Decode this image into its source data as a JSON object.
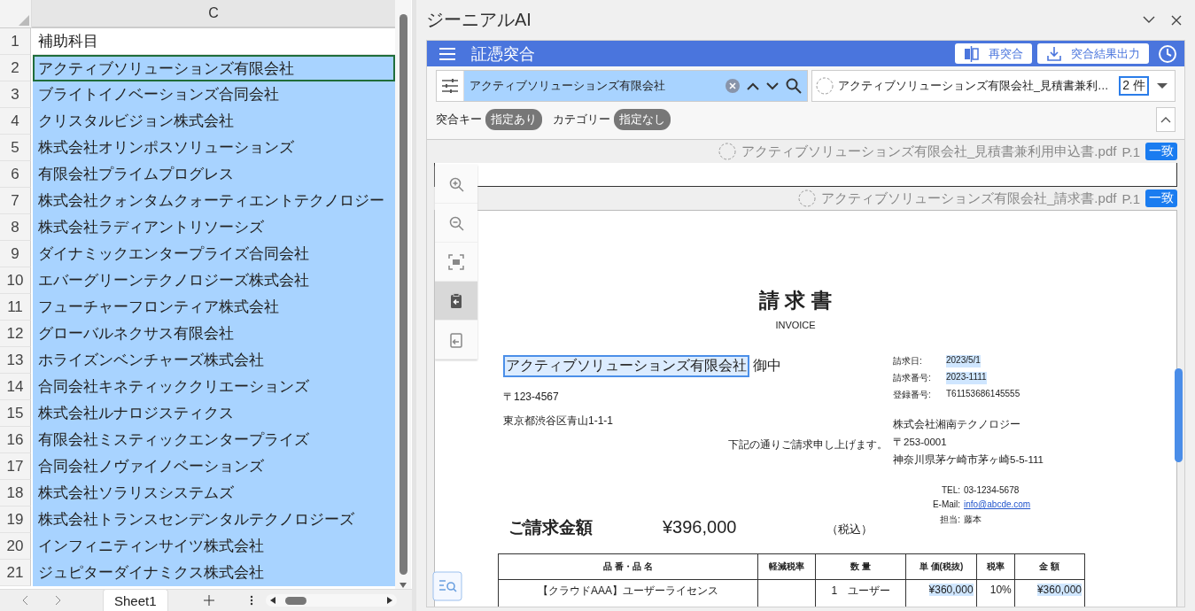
{
  "sheet": {
    "column": "C",
    "rows": [
      {
        "number": "1",
        "value": "補助科目",
        "selected": false,
        "active": false
      },
      {
        "number": "2",
        "value": "アクティブソリューションズ有限会社",
        "selected": true,
        "active": true
      },
      {
        "number": "3",
        "value": "ブライトイノベーションズ合同会社",
        "selected": true,
        "active": false
      },
      {
        "number": "4",
        "value": "クリスタルビジョン株式会社",
        "selected": true,
        "active": false
      },
      {
        "number": "5",
        "value": "株式会社オリンポスソリューションズ",
        "selected": true,
        "active": false
      },
      {
        "number": "6",
        "value": "有限会社プライムプログレス",
        "selected": true,
        "active": false
      },
      {
        "number": "7",
        "value": "株式会社クォンタムクォーティエントテクノロジー",
        "selected": true,
        "active": false
      },
      {
        "number": "8",
        "value": "株式会社ラディアントリソーシズ",
        "selected": true,
        "active": false
      },
      {
        "number": "9",
        "value": "ダイナミックエンタープライズ合同会社",
        "selected": true,
        "active": false
      },
      {
        "number": "10",
        "value": "エバーグリーンテクノロジーズ株式会社",
        "selected": true,
        "active": false
      },
      {
        "number": "11",
        "value": "フューチャーフロンティア株式会社",
        "selected": true,
        "active": false
      },
      {
        "number": "12",
        "value": "グローバルネクサス有限会社",
        "selected": true,
        "active": false
      },
      {
        "number": "13",
        "value": "ホライズンベンチャーズ株式会社",
        "selected": true,
        "active": false
      },
      {
        "number": "14",
        "value": "合同会社キネティッククリエーションズ",
        "selected": true,
        "active": false
      },
      {
        "number": "15",
        "value": "株式会社ルナロジスティクス",
        "selected": true,
        "active": false
      },
      {
        "number": "16",
        "value": "有限会社ミスティックエンタープライズ",
        "selected": true,
        "active": false
      },
      {
        "number": "17",
        "value": "合同会社ノヴァイノベーションズ",
        "selected": true,
        "active": false
      },
      {
        "number": "18",
        "value": "株式会社ソラリスシステムズ",
        "selected": true,
        "active": false
      },
      {
        "number": "19",
        "value": "株式会社トランスセンデンタルテクノロジーズ",
        "selected": true,
        "active": false
      },
      {
        "number": "20",
        "value": "インフィニティンサイツ株式会社",
        "selected": true,
        "active": false
      },
      {
        "number": "21",
        "value": "ジュピターダイナミクス株式会社",
        "selected": true,
        "active": false
      }
    ],
    "tabs": [
      {
        "label": "Sheet1",
        "selected": true
      }
    ]
  },
  "panel": {
    "title": "ジーニアルAI",
    "toolbar_title": "証憑突合",
    "buttons": [
      {
        "kind": "rematch",
        "label": "再突合"
      },
      {
        "kind": "export",
        "label": "突合結果出力"
      }
    ],
    "search": {
      "value": "アクティブソリューションズ有限会社"
    },
    "result": {
      "value": "アクティブソリューションズ有限会社_見積書兼利…",
      "count": "2 件"
    },
    "filters": [
      {
        "label": "突合キー",
        "chip": "指定あり"
      },
      {
        "label": "カテゴリー",
        "chip": "指定なし"
      }
    ],
    "zoom_tools": [
      {
        "kind": "zoom-in",
        "selected": false
      },
      {
        "kind": "zoom-out",
        "selected": false
      },
      {
        "kind": "fit",
        "selected": false
      },
      {
        "kind": "paste",
        "selected": true
      },
      {
        "kind": "clipboard",
        "selected": false
      }
    ],
    "documents": [
      {
        "file": "アクティブソリューションズ有限会社_見積書兼利用申込書.pdf",
        "page": "P.1",
        "badge": "一致"
      },
      {
        "file": "アクティブソリューションズ有限会社_請求書.pdf",
        "page": "P.1",
        "badge": "一致"
      }
    ],
    "invoice": {
      "title": "請 求 書",
      "subtitle": "INVOICE",
      "recipient": "アクティブソリューションズ有限会社",
      "recipient_matched": true,
      "honorific": "御中",
      "postal": "〒123-4567",
      "address": "東京都渋谷区青山1-1-1",
      "note": "下記の通りご請求申し上げます。",
      "meta": [
        {
          "label": "請求日:",
          "value": "2023/5/1",
          "highlighted": true
        },
        {
          "label": "請求番号:",
          "value": "2023-1111",
          "highlighted": true
        },
        {
          "label": "登録番号:",
          "value": "T61153686145555",
          "highlighted": false
        }
      ],
      "issuer": [
        "株式会社湘南テクノロジー",
        "〒253-0001",
        "神奈川県茅ケ崎市茅ヶ崎5-5-111"
      ],
      "contacts": [
        {
          "label": "TEL:",
          "value": "03-1234-5678",
          "kind": "text"
        },
        {
          "label": "E-Mail:",
          "value": "info@abcde.com",
          "kind": "link"
        },
        {
          "label": "担当:",
          "value": "藤本",
          "kind": "text"
        }
      ],
      "amount_label": "ご請求金額",
      "amount": "¥396,000",
      "tax_note": "（税込）",
      "table": {
        "columns": [
          "品 番・品 名",
          "軽減税率",
          "数 量",
          "単 価(税抜)",
          "税率",
          "金 額"
        ],
        "rows": [
          {
            "item": "【クラウドAAA】ユーザーライセンス",
            "quantity": "1　ユーザー",
            "unit_price": "¥360,000",
            "unit_price_highlighted": true,
            "tax_rate": "10%",
            "amount": "¥360,000",
            "amount_highlighted": true
          }
        ]
      }
    }
  }
}
